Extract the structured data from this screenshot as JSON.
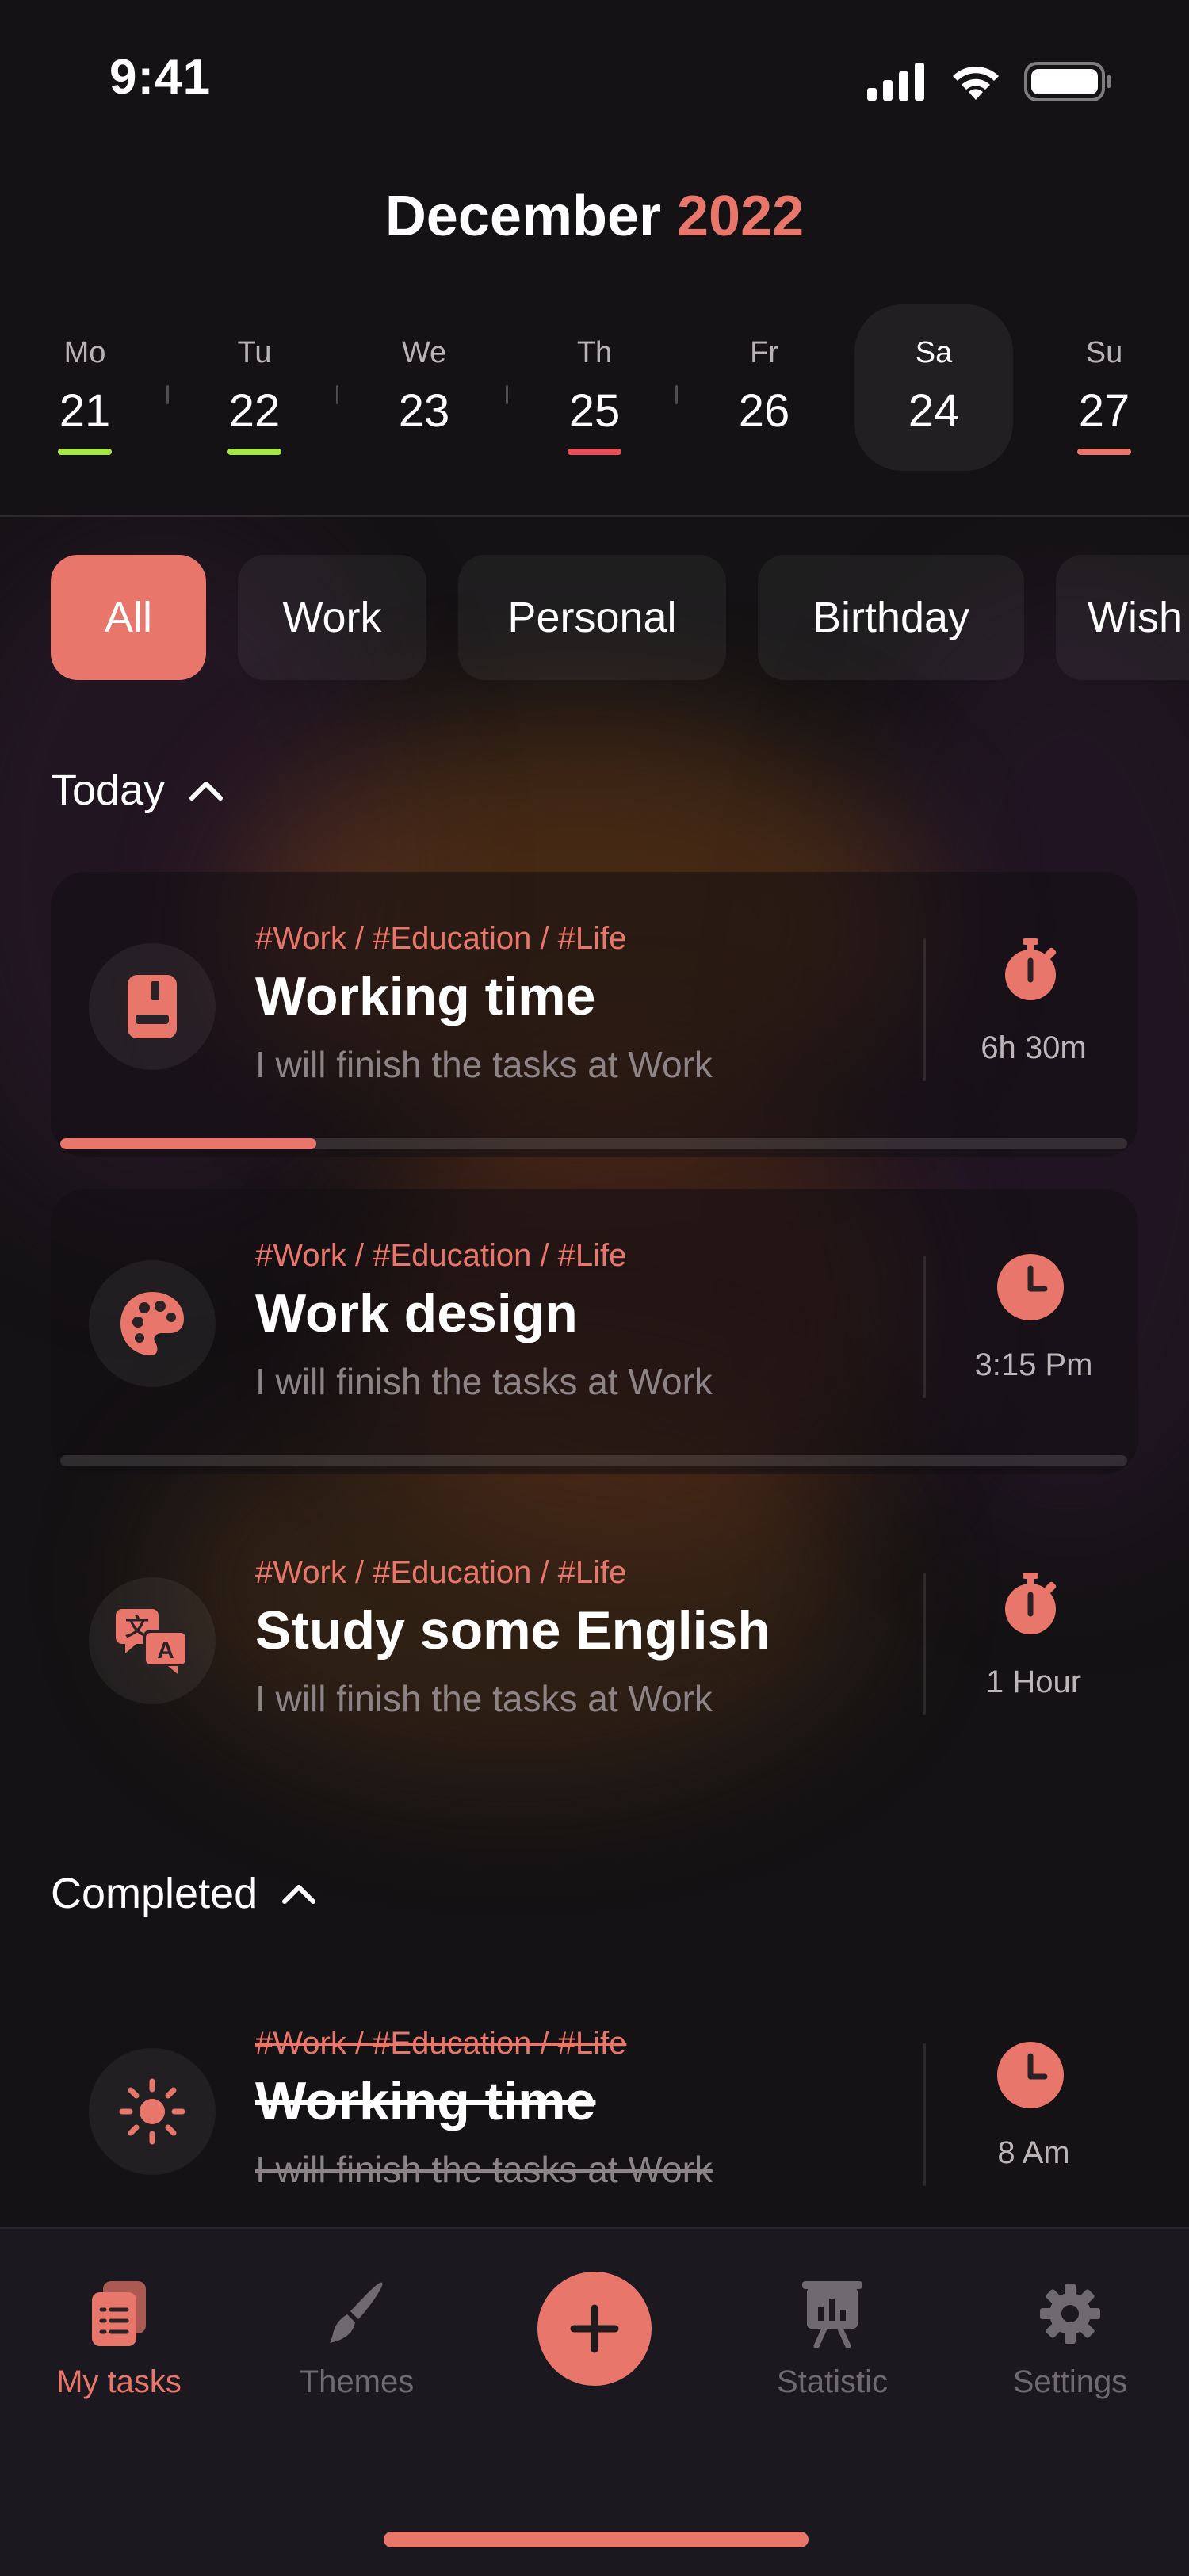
{
  "status_bar": {
    "time": "9:41"
  },
  "header": {
    "month": "December",
    "year": "2022"
  },
  "week": [
    {
      "name": "Mo",
      "date": "21",
      "mark": "#a6e84a"
    },
    {
      "name": "Tu",
      "date": "22",
      "mark": "#a6e84a"
    },
    {
      "name": "We",
      "date": "23",
      "mark": ""
    },
    {
      "name": "Th",
      "date": "25",
      "mark": "#e8505a"
    },
    {
      "name": "Fr",
      "date": "26",
      "mark": ""
    },
    {
      "name": "Sa",
      "date": "24",
      "mark": "",
      "selected": true
    },
    {
      "name": "Su",
      "date": "27",
      "mark": "#e8766a"
    }
  ],
  "filters": [
    "All",
    "Work",
    "Personal",
    "Birthday",
    "Wish"
  ],
  "active_filter": "All",
  "sections": {
    "today": "Today",
    "completed": "Completed"
  },
  "tasks": [
    {
      "tags": "#Work / #Education / #Life",
      "title": "Working time",
      "desc": "I will finish the tasks at Work",
      "icon": "book-icon",
      "right_icon": "stopwatch-icon",
      "right_label": "6h 30m",
      "progress": 0.24
    },
    {
      "tags": "#Work / #Education / #Life",
      "title": "Work design",
      "desc": "I will finish the tasks at Work",
      "icon": "palette-icon",
      "right_icon": "clock-icon",
      "right_label": "3:15 Pm",
      "progress": 0
    },
    {
      "tags": "#Work / #Education / #Life",
      "title": "Study some English",
      "desc": "I will finish the tasks at Work",
      "icon": "translate-icon",
      "right_icon": "stopwatch-icon",
      "right_label": "1  Hour"
    }
  ],
  "completed": [
    {
      "tags": "#Work / #Education / #Life",
      "title": "Working time",
      "desc": "I will finish the tasks at Work",
      "icon": "sun-icon",
      "right_icon": "clock-icon",
      "right_label": "8 Am"
    }
  ],
  "nav": {
    "my_tasks": "My tasks",
    "themes": "Themes",
    "statistic": "Statistic",
    "settings": "Settings"
  },
  "colors": {
    "accent": "#e8766a",
    "background": "#141214"
  }
}
